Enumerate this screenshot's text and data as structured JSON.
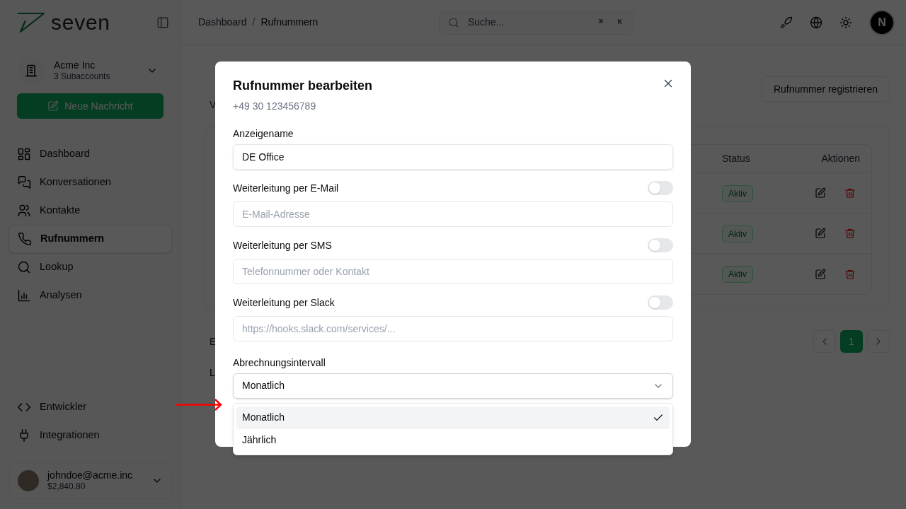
{
  "sidebar": {
    "logo_text": "seven",
    "account": {
      "name": "Acme Inc",
      "subaccounts": "3 Subaccounts"
    },
    "new_message_button": "Neue Nachricht",
    "nav_items": [
      {
        "label": "Dashboard",
        "selected": false
      },
      {
        "label": "Konversationen",
        "selected": false
      },
      {
        "label": "Kontakte",
        "selected": false
      },
      {
        "label": "Rufnummern",
        "selected": true
      },
      {
        "label": "Lookup",
        "selected": false
      },
      {
        "label": "Analysen",
        "selected": false
      }
    ],
    "bottom_items": [
      {
        "label": "Entwickler",
        "selected": false
      },
      {
        "label": "Integrationen",
        "selected": false
      }
    ],
    "user": {
      "email": "johndoe@acme.inc",
      "balance": "$2,840.80"
    }
  },
  "header": {
    "breadcrumb": [
      "Dashboard",
      "Rufnummern"
    ],
    "breadcrumb_separator": "/",
    "search": {
      "placeholder": "Suche...",
      "shortcut": [
        "⌘",
        "K"
      ]
    },
    "avatar": "N"
  },
  "page": {
    "subtitle_fragment": "V",
    "register_button": "Rufnummer registrieren",
    "table": {
      "columns": [
        "Status",
        "Aktionen"
      ],
      "rows": [
        {
          "status": "Aktiv"
        },
        {
          "status": "Aktiv"
        },
        {
          "status": "Aktiv"
        }
      ]
    },
    "footer_fragment": "E",
    "lower_fragment": "L",
    "pagination": [
      {
        "label": "1",
        "selected": true
      }
    ]
  },
  "dialog": {
    "title": "Rufnummer bearbeiten",
    "subtitle": "+49 30 123456789",
    "fields": [
      {
        "kind": "text",
        "label": "Anzeigename",
        "value": "DE Office"
      },
      {
        "kind": "toggle",
        "label": "Weiterleitung per E-Mail",
        "on": false,
        "placeholder": "E-Mail-Adresse"
      },
      {
        "kind": "toggle",
        "label": "Weiterleitung per SMS",
        "on": false,
        "placeholder": "Telefonnummer oder Kontakt"
      },
      {
        "kind": "toggle",
        "label": "Weiterleitung per Slack",
        "on": false,
        "placeholder": "https://hooks.slack.com/services/..."
      }
    ],
    "select": {
      "label": "Abrechnungsintervall",
      "value": "Monatlich",
      "expanded": true,
      "options": [
        {
          "label": "Monatlich",
          "selected": true
        },
        {
          "label": "Jährlich",
          "selected": false
        }
      ]
    }
  }
}
